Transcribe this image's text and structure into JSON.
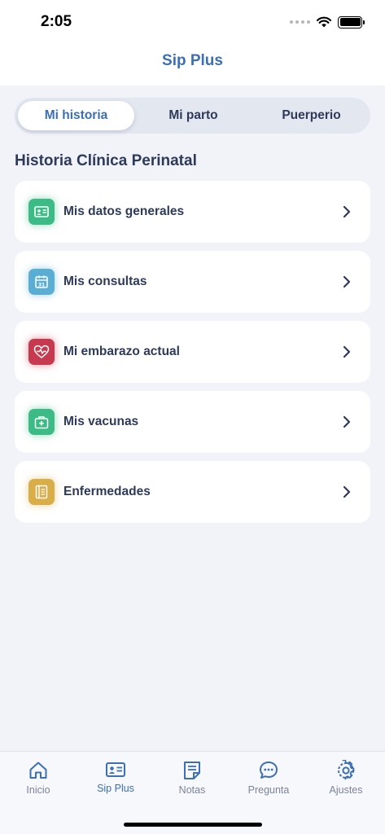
{
  "status_bar": {
    "time": "2:05"
  },
  "header": {
    "title": "Sip Plus"
  },
  "tabs": [
    {
      "label": "Mi historia",
      "active": true
    },
    {
      "label": "Mi parto",
      "active": false
    },
    {
      "label": "Puerperio",
      "active": false
    }
  ],
  "section": {
    "title": "Historia Clínica Perinatal"
  },
  "items": [
    {
      "label": "Mis datos generales",
      "icon": "id-card-icon",
      "color": "#3dbb86"
    },
    {
      "label": "Mis consultas",
      "icon": "calendar-icon",
      "color": "#5aaed3"
    },
    {
      "label": "Mi embarazo actual",
      "icon": "heart-pulse-icon",
      "color": "#c7394f"
    },
    {
      "label": "Mis vacunas",
      "icon": "first-aid-kit-icon",
      "color": "#3dbb86"
    },
    {
      "label": "Enfermedades",
      "icon": "notebook-icon",
      "color": "#d9ae48"
    }
  ],
  "bottom_nav": [
    {
      "label": "Inicio",
      "icon": "home-icon",
      "active": false
    },
    {
      "label": "Sip Plus",
      "icon": "id-card-icon",
      "active": true
    },
    {
      "label": "Notas",
      "icon": "notes-icon",
      "active": false
    },
    {
      "label": "Pregunta",
      "icon": "chat-bubble-icon",
      "active": false
    },
    {
      "label": "Ajustes",
      "icon": "gear-icon",
      "active": false
    }
  ]
}
